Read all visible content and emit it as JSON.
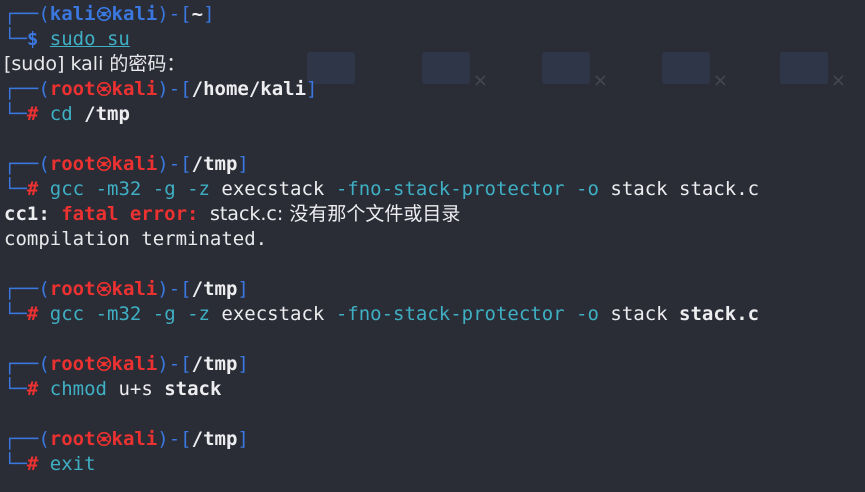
{
  "terminal": {
    "colors": {
      "prompt_frame": "#3a78e0",
      "root_user": "#ec3131",
      "command": "#3fb0c4",
      "error": "#ec3131",
      "background": "#2a2c36"
    },
    "prompt_kali": {
      "user": "kali",
      "host": "kali",
      "path": "~",
      "symbol": "$",
      "command": "sudo su"
    },
    "sudo_prompt": "[sudo] kali 的密码：",
    "blocks": [
      {
        "user": "root",
        "host": "kali",
        "path": "/home/kali",
        "symbol": "#",
        "cmd_name": "cd",
        "cmd_args": "/tmp",
        "output": []
      },
      {
        "user": "root",
        "host": "kali",
        "path": "/tmp",
        "symbol": "#",
        "cmd_name": "gcc",
        "cmd_args_1": "-m32 -g -z",
        "cmd_args_2": "execstack",
        "cmd_args_3": "-fno-stack-protector -o",
        "cmd_args_4": "stack stack.c",
        "error_prefix": "cc1:",
        "error_kind": "fatal error:",
        "error_msg": "stack.c: 没有那个文件或目录",
        "error_tail": "compilation terminated."
      },
      {
        "user": "root",
        "host": "kali",
        "path": "/tmp",
        "symbol": "#",
        "cmd_name": "gcc",
        "cmd_args_1": "-m32 -g -z",
        "cmd_args_2": "execstack",
        "cmd_args_3": "-fno-stack-protector -o",
        "cmd_args_4": "stack",
        "cmd_args_5": "stack.c"
      },
      {
        "user": "root",
        "host": "kali",
        "path": "/tmp",
        "symbol": "#",
        "cmd_name": "chmod",
        "cmd_args_1": "u+s",
        "cmd_args_2": "stack"
      },
      {
        "user": "root",
        "host": "kali",
        "path": "/tmp",
        "symbol": "#",
        "cmd_name": "exit"
      }
    ]
  }
}
